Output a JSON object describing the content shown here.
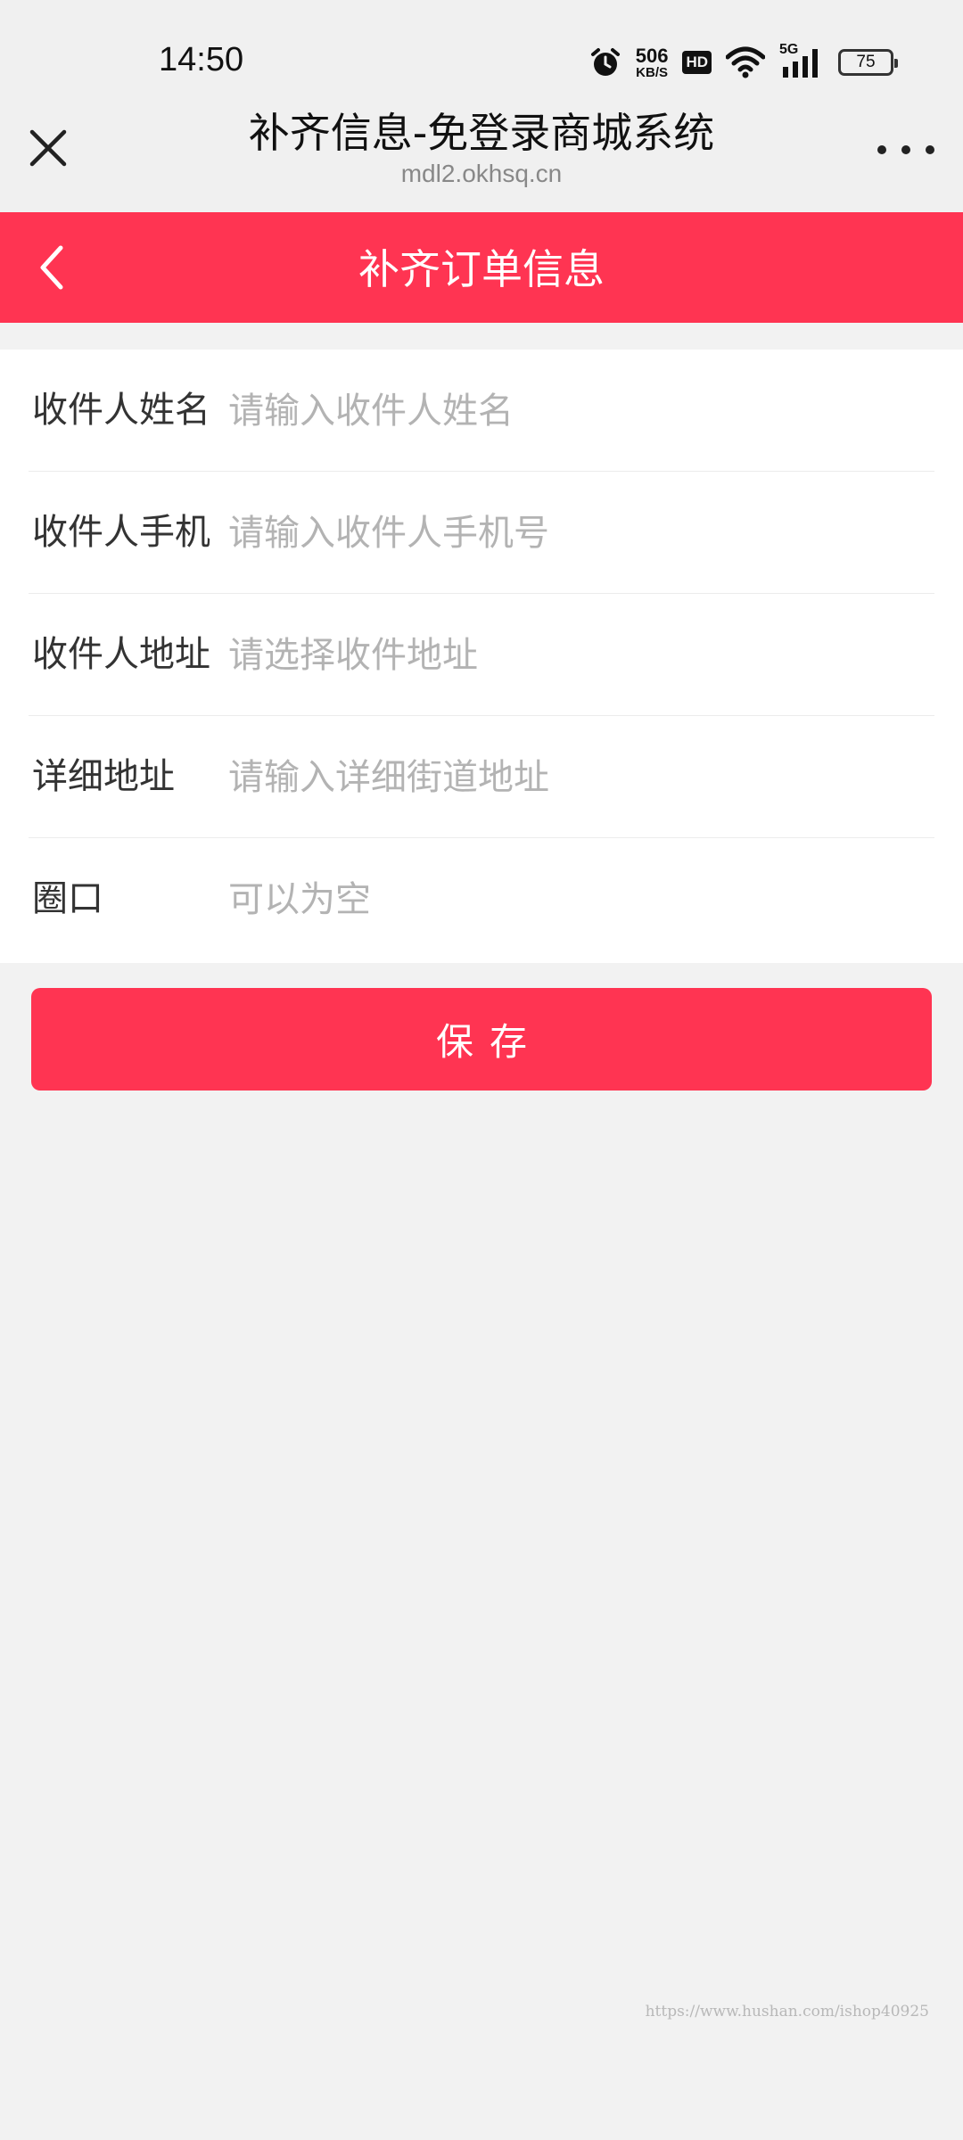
{
  "status_bar": {
    "time": "14:50",
    "net_speed_value": "506",
    "net_speed_unit": "KB/S",
    "hd_badge": "HD",
    "network_type": "5G",
    "battery_level": "75",
    "icons": [
      "alarm-icon",
      "wifi-icon",
      "signal-icon",
      "battery-icon"
    ]
  },
  "webview": {
    "title": "补齐信息-免登录商城系统",
    "domain": "mdl2.okhsq.cn"
  },
  "header": {
    "title": "补齐订单信息"
  },
  "form": {
    "fields": [
      {
        "label": "收件人姓名",
        "placeholder": "请输入收件人姓名",
        "value": ""
      },
      {
        "label": "收件人手机",
        "placeholder": "请输入收件人手机号",
        "value": ""
      },
      {
        "label": "收件人地址",
        "placeholder": "请选择收件地址",
        "value": ""
      },
      {
        "label": "详细地址",
        "placeholder": "请输入详细街道地址",
        "value": ""
      },
      {
        "label": "圈口",
        "placeholder": "可以为空",
        "value": ""
      }
    ]
  },
  "actions": {
    "save_label": "保存"
  },
  "watermark": "https://www.hushan.com/ishop40925",
  "colors": {
    "accent": "#ff3452",
    "background": "#f2f2f2",
    "placeholder": "#b3b3b3"
  }
}
